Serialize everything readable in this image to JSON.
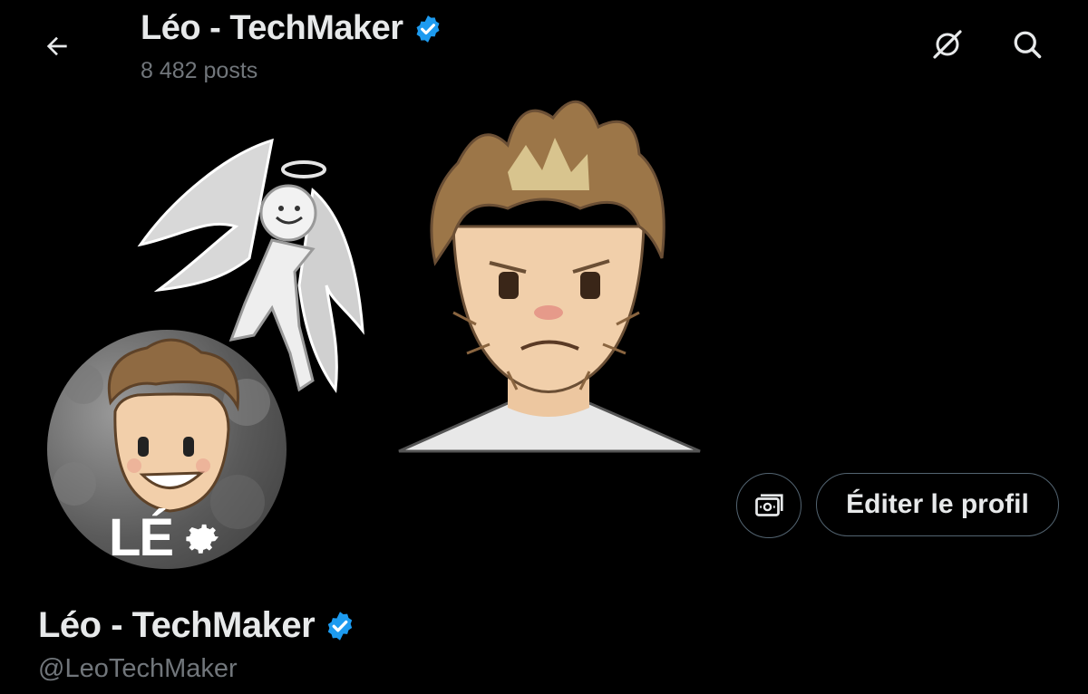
{
  "header": {
    "name": "Léo - TechMaker",
    "posts": "8 482 posts",
    "back_icon": "arrow-left-icon",
    "grok_icon": "grok-icon",
    "search_icon": "search-icon"
  },
  "banner": {
    "description_icon": "banner-illustration"
  },
  "avatar": {
    "text": "LÉ",
    "gear_icon": "gear-icon"
  },
  "actions": {
    "subscriptions_icon": "money-icon",
    "edit_label": "Éditer le profil"
  },
  "profile": {
    "name": "Léo - TechMaker",
    "handle": "@LeoTechMaker"
  },
  "colors": {
    "background": "#000000",
    "text": "#e7e9ea",
    "muted": "#71767b",
    "border": "#536471",
    "verified": "#1d9bf0"
  }
}
